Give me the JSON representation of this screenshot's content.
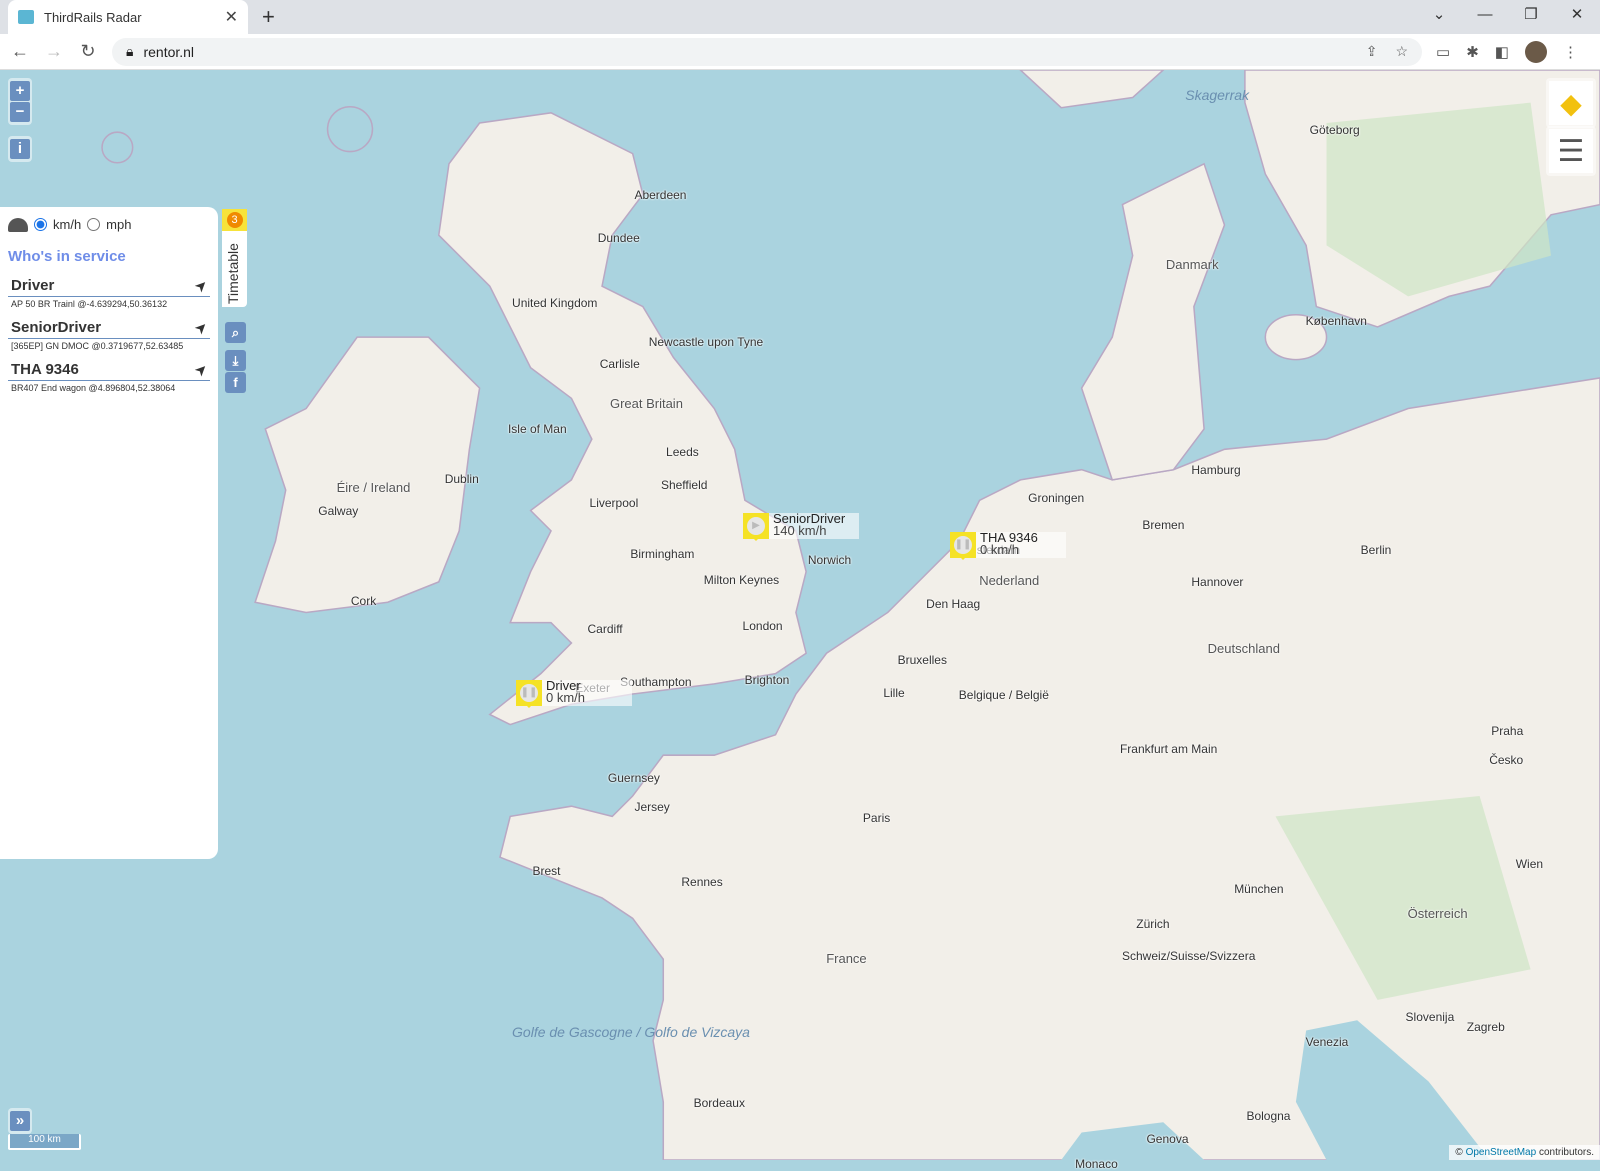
{
  "browser": {
    "tab_title": "ThirdRails Radar",
    "url": "rentor.nl"
  },
  "units": {
    "kmh": "km/h",
    "mph": "mph",
    "selected": "km/h"
  },
  "panel": {
    "title": "Who's in service",
    "drivers": [
      {
        "name": "Driver",
        "info": "AP 50 BR Trainl @-4.639294,50.36132"
      },
      {
        "name": "SeniorDriver",
        "info": "[365EP] GN DMOC @0.3719677,52.63485"
      },
      {
        "name": "THA 9346",
        "info": "BR407 End wagon @4.896804,52.38064"
      }
    ]
  },
  "timetable": {
    "label": "Timetable",
    "badge": "3"
  },
  "markers": [
    {
      "name": "SeniorDriver",
      "speed": "140 km/h",
      "state": "playing"
    },
    {
      "name": "THA 9346",
      "speed": "0 km/h",
      "state": "paused"
    },
    {
      "name": "Driver",
      "speed": "0 km/h",
      "state": "paused"
    }
  ],
  "map": {
    "scale": "100 km",
    "attribution_prefix": "©",
    "attribution_link": "OpenStreetMap",
    "attribution_suffix": "contributors.",
    "labels": [
      "Great Britain",
      "United Kingdom",
      "Éire / Ireland",
      "Dublin",
      "Isle of Man",
      "Leeds",
      "Sheffield",
      "Liverpool",
      "Birmingham",
      "London",
      "Cardiff",
      "Norwich",
      "Aberdeen",
      "Dundee",
      "Newcastle upon Tyne",
      "Carlisle",
      "Cork",
      "Galway",
      "Exeter",
      "Southampton",
      "Brighton",
      "Nederland",
      "Den Haag",
      "Groningen",
      "Hamburg",
      "Bremen",
      "Berlin",
      "Hannover",
      "Deutschland",
      "Danmark",
      "København",
      "Göteborg",
      "Paris",
      "Rennes",
      "Brest",
      "France",
      "Belgique / België",
      "Lille",
      "Frankfurt am Main",
      "München",
      "Praha",
      "Wien",
      "Zürich",
      "Schweiz/Suisse/Svizzera",
      "Bordeaux",
      "Venezia",
      "Zagreb",
      "Slovenija",
      "Bologna",
      "Genova",
      "Monaco",
      "Skagerrak",
      "Golfe de Gascogne / Golfo de Vizcaya",
      "Guernsey",
      "Jersey",
      "Österreich",
      "Česko",
      "Milton Keynes",
      "Bruxelles",
      "Amsterdam"
    ]
  }
}
